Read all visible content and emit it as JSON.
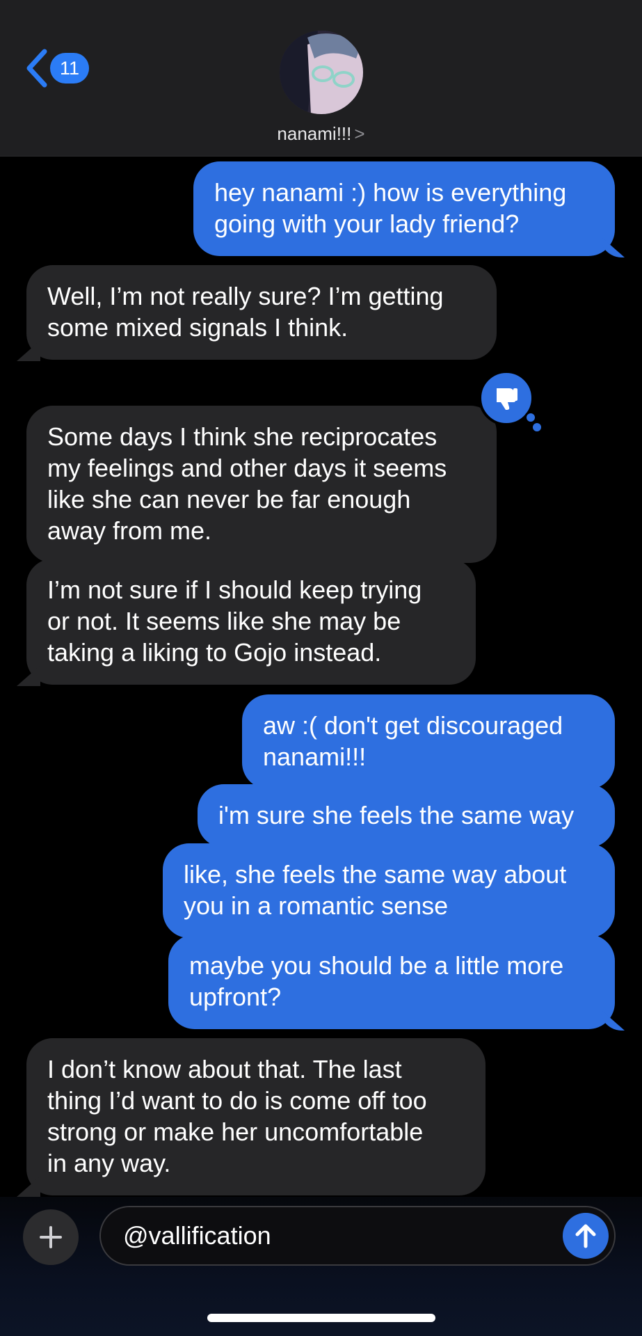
{
  "header": {
    "unread_count": "11",
    "contact_name": "nanami!!!",
    "chevron": ">"
  },
  "messages": [
    {
      "side": "sent",
      "text": "hey nanami :) how is everything\ngoing with your lady friend?"
    },
    {
      "side": "recv",
      "text": "Well, I’m not really sure? I’m getting\nsome mixed signals I think."
    },
    {
      "side": "recv",
      "text": "Some days I think she reciprocates\nmy feelings and other days it seems\nlike she can never be far enough\naway from me.",
      "tapback": "thumbs-down"
    },
    {
      "side": "recv",
      "text": "I’m not sure if I should keep trying\nor not. It seems like she may be\ntaking a liking to Gojo instead."
    },
    {
      "side": "sent",
      "text": "aw :( don't get discouraged\nnanami!!!"
    },
    {
      "side": "sent",
      "text": "i'm sure she feels the same way"
    },
    {
      "side": "sent",
      "text": "like, she feels the same way about\nyou in a romantic sense"
    },
    {
      "side": "sent",
      "text": "maybe you should be a little more\nupfront?"
    },
    {
      "side": "recv",
      "text": "I don’t know about that. The last\nthing I’d want to do is come off too\nstrong or make her uncomfortable\nin any way."
    }
  ],
  "composer": {
    "value": "@vallification"
  },
  "colors": {
    "sent_bubble": "#2e6fe0",
    "received_bubble": "#262628",
    "accent": "#2b7cf6"
  }
}
